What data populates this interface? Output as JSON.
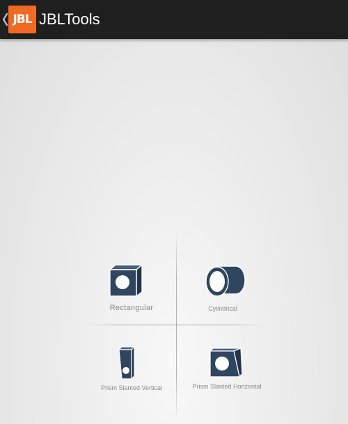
{
  "app_bar": {
    "back_icon": "chevron-left-icon",
    "logo_text": "JBL",
    "logo_color": "#f26a22",
    "title": "JBLTools",
    "background": "#1f1f1f"
  },
  "enclosure_types": [
    {
      "label": "Rectangular",
      "icon": "rectangular-box-icon"
    },
    {
      "label": "Cylindrical",
      "icon": "cylindrical-box-icon"
    },
    {
      "label": "Prism Slanted Vertical",
      "icon": "prism-slanted-vertical-icon"
    },
    {
      "label": "Prism Slanted Horizontal",
      "icon": "prism-slanted-horizontal-icon"
    }
  ],
  "icon_fill_color": "#2f4560",
  "icon_stroke_color": "#ffffff"
}
